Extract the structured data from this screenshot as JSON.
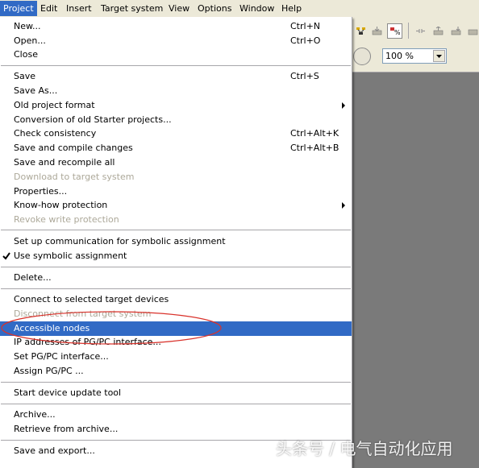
{
  "menubar": {
    "items": [
      {
        "label": "Project"
      },
      {
        "label": "Edit"
      },
      {
        "label": "Insert"
      },
      {
        "label": "Target system"
      },
      {
        "label": "View"
      },
      {
        "label": "Options"
      },
      {
        "label": "Window"
      },
      {
        "label": "Help"
      }
    ]
  },
  "toolbar": {
    "zoom_value": "100 %"
  },
  "project_menu": {
    "items": [
      {
        "label": "New...",
        "shortcut": "Ctrl+N",
        "enabled": true
      },
      {
        "label": "Open...",
        "shortcut": "Ctrl+O",
        "enabled": true
      },
      {
        "label": "Close",
        "shortcut": "",
        "enabled": true
      },
      {
        "label": "Save",
        "shortcut": "Ctrl+S",
        "enabled": true
      },
      {
        "label": "Save As...",
        "shortcut": "",
        "enabled": true
      },
      {
        "label": "Old project format",
        "shortcut": "",
        "enabled": true,
        "submenu": true
      },
      {
        "label": "Conversion of old Starter projects...",
        "shortcut": "",
        "enabled": true
      },
      {
        "label": "Check consistency",
        "shortcut": "Ctrl+Alt+K",
        "enabled": true
      },
      {
        "label": "Save and compile changes",
        "shortcut": "Ctrl+Alt+B",
        "enabled": true
      },
      {
        "label": "Save and recompile all",
        "shortcut": "",
        "enabled": true
      },
      {
        "label": "Download to target system",
        "shortcut": "",
        "enabled": false
      },
      {
        "label": "Properties...",
        "shortcut": "",
        "enabled": true
      },
      {
        "label": "Know-how protection",
        "shortcut": "",
        "enabled": true,
        "submenu": true
      },
      {
        "label": "Revoke write protection",
        "shortcut": "",
        "enabled": false
      },
      {
        "label": "Set up communication for symbolic assignment",
        "shortcut": "",
        "enabled": true
      },
      {
        "label": "Use symbolic assignment",
        "shortcut": "",
        "enabled": true,
        "checked": true
      },
      {
        "label": "Delete...",
        "shortcut": "",
        "enabled": true
      },
      {
        "label": "Connect to selected target devices",
        "shortcut": "",
        "enabled": true
      },
      {
        "label": "Disconnect from target system",
        "shortcut": "",
        "enabled": false
      },
      {
        "label": "Accessible nodes",
        "shortcut": "",
        "enabled": true,
        "selected": true
      },
      {
        "label": "IP addresses of PG/PC interface...",
        "shortcut": "",
        "enabled": true
      },
      {
        "label": "Set PG/PC interface...",
        "shortcut": "",
        "enabled": true
      },
      {
        "label": "Assign PG/PC ...",
        "shortcut": "",
        "enabled": true
      },
      {
        "label": "Start device update tool",
        "shortcut": "",
        "enabled": true
      },
      {
        "label": "Archive...",
        "shortcut": "",
        "enabled": true
      },
      {
        "label": "Retrieve from archive...",
        "shortcut": "",
        "enabled": true
      },
      {
        "label": "Save and export...",
        "shortcut": "",
        "enabled": true
      }
    ]
  },
  "watermark": "头条号 / 电气自动化应用",
  "colors": {
    "menu_highlight": "#316ac5",
    "annotation": "#d9322b",
    "disabled_text": "#aca899"
  }
}
